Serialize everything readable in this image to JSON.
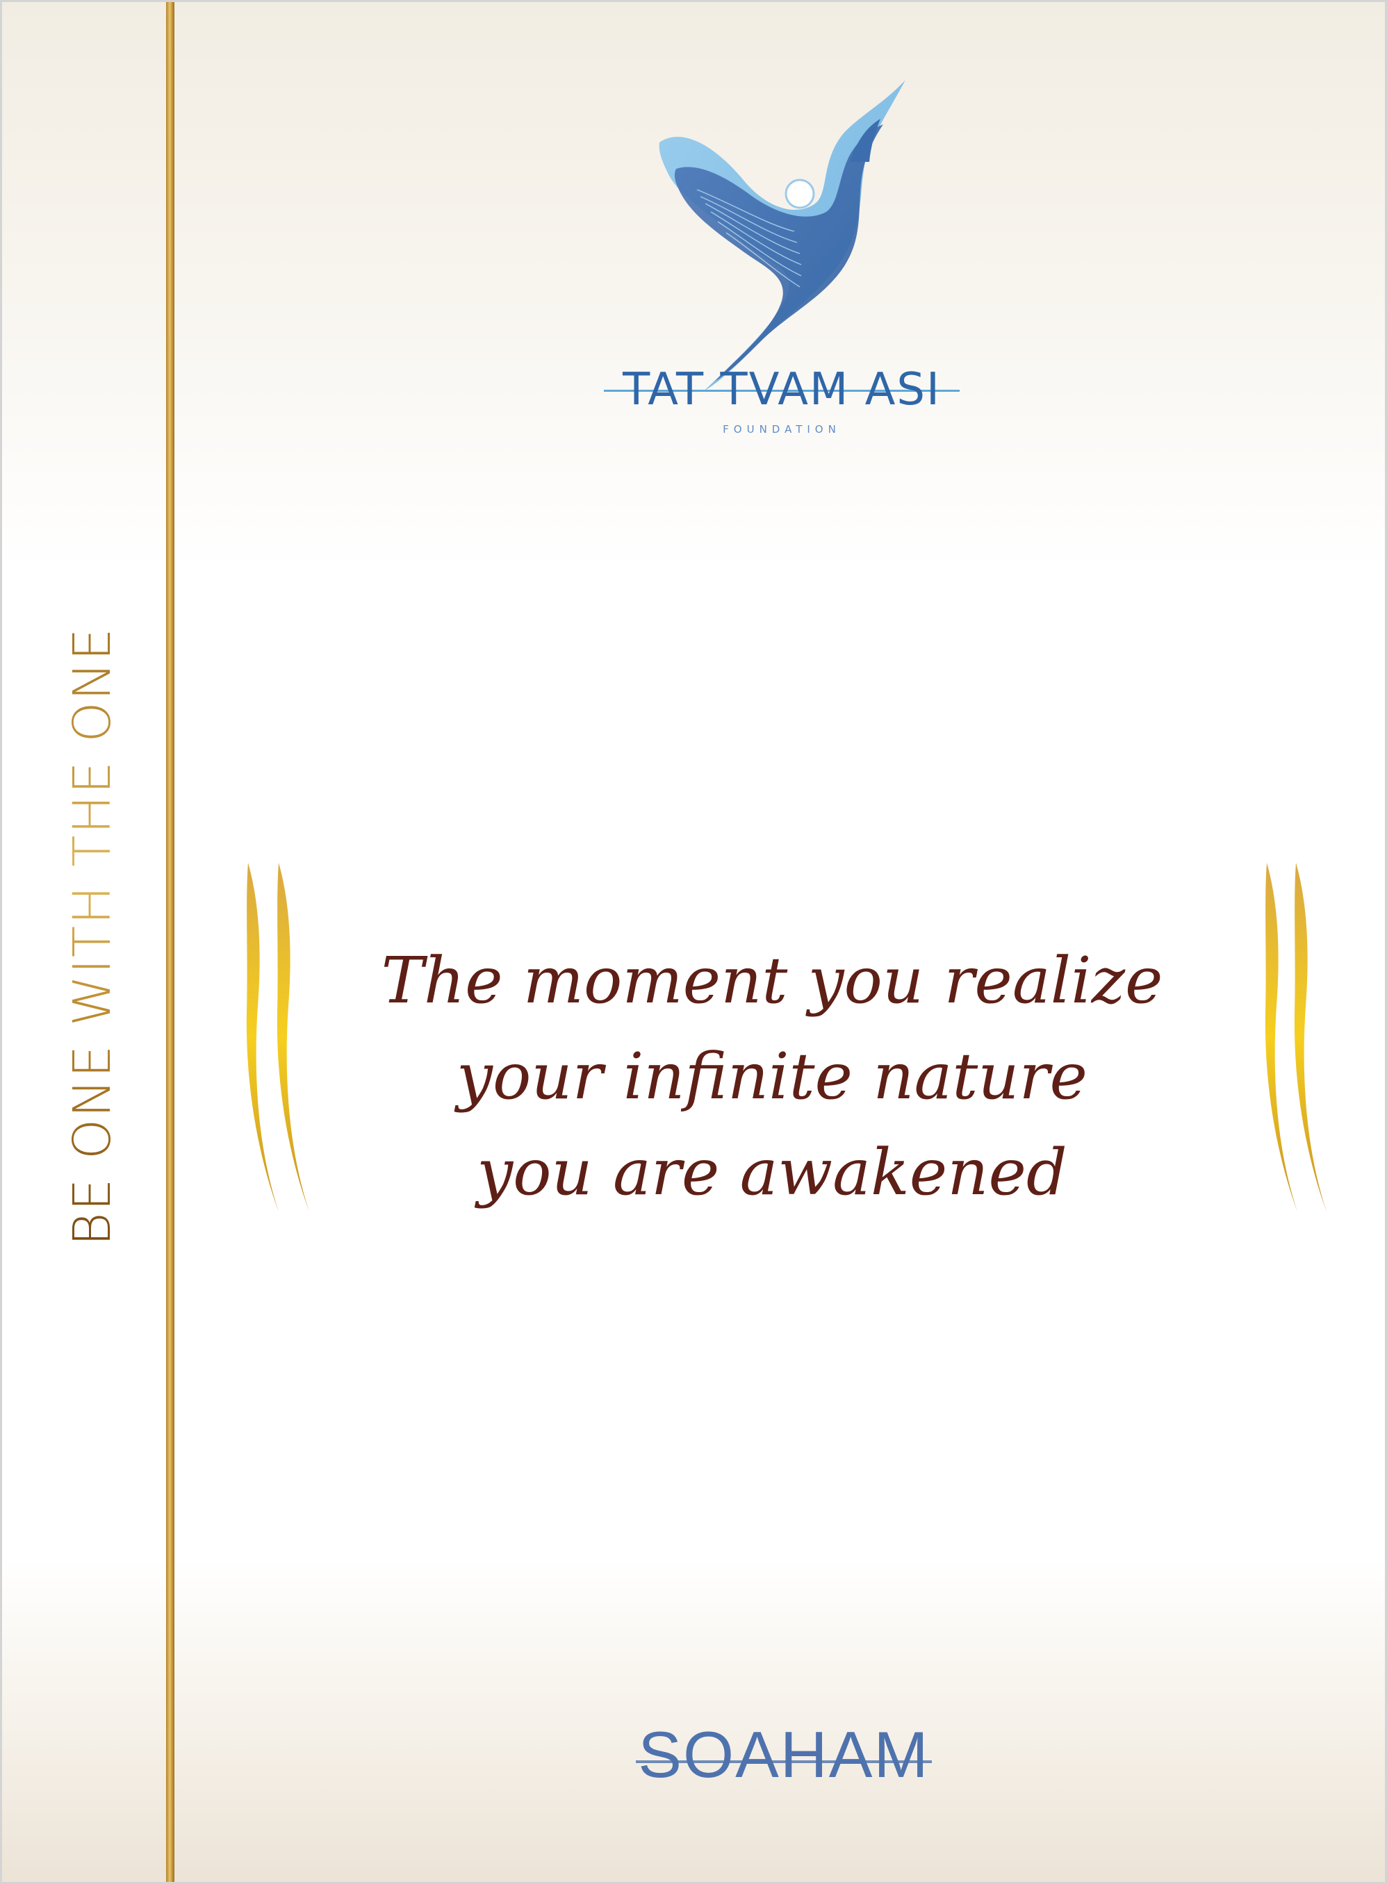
{
  "sidebar": {
    "tagline": "BE ONE WITH THE ONE"
  },
  "logo": {
    "wordmark": "TAT TVAM ASI",
    "subtitle": "FOUNDATION",
    "icon": "bird-icon"
  },
  "quote": {
    "lines": [
      "The moment you realize",
      "your infinite nature",
      "you are awakened"
    ]
  },
  "signature": "SOAHAM",
  "colors": {
    "gold": "#c79a3d",
    "quote_text": "#5e1f16",
    "brand_blue": "#2f66a8",
    "signature_blue": "#4e72ad",
    "bracket_yellow": "#f4c21c"
  }
}
